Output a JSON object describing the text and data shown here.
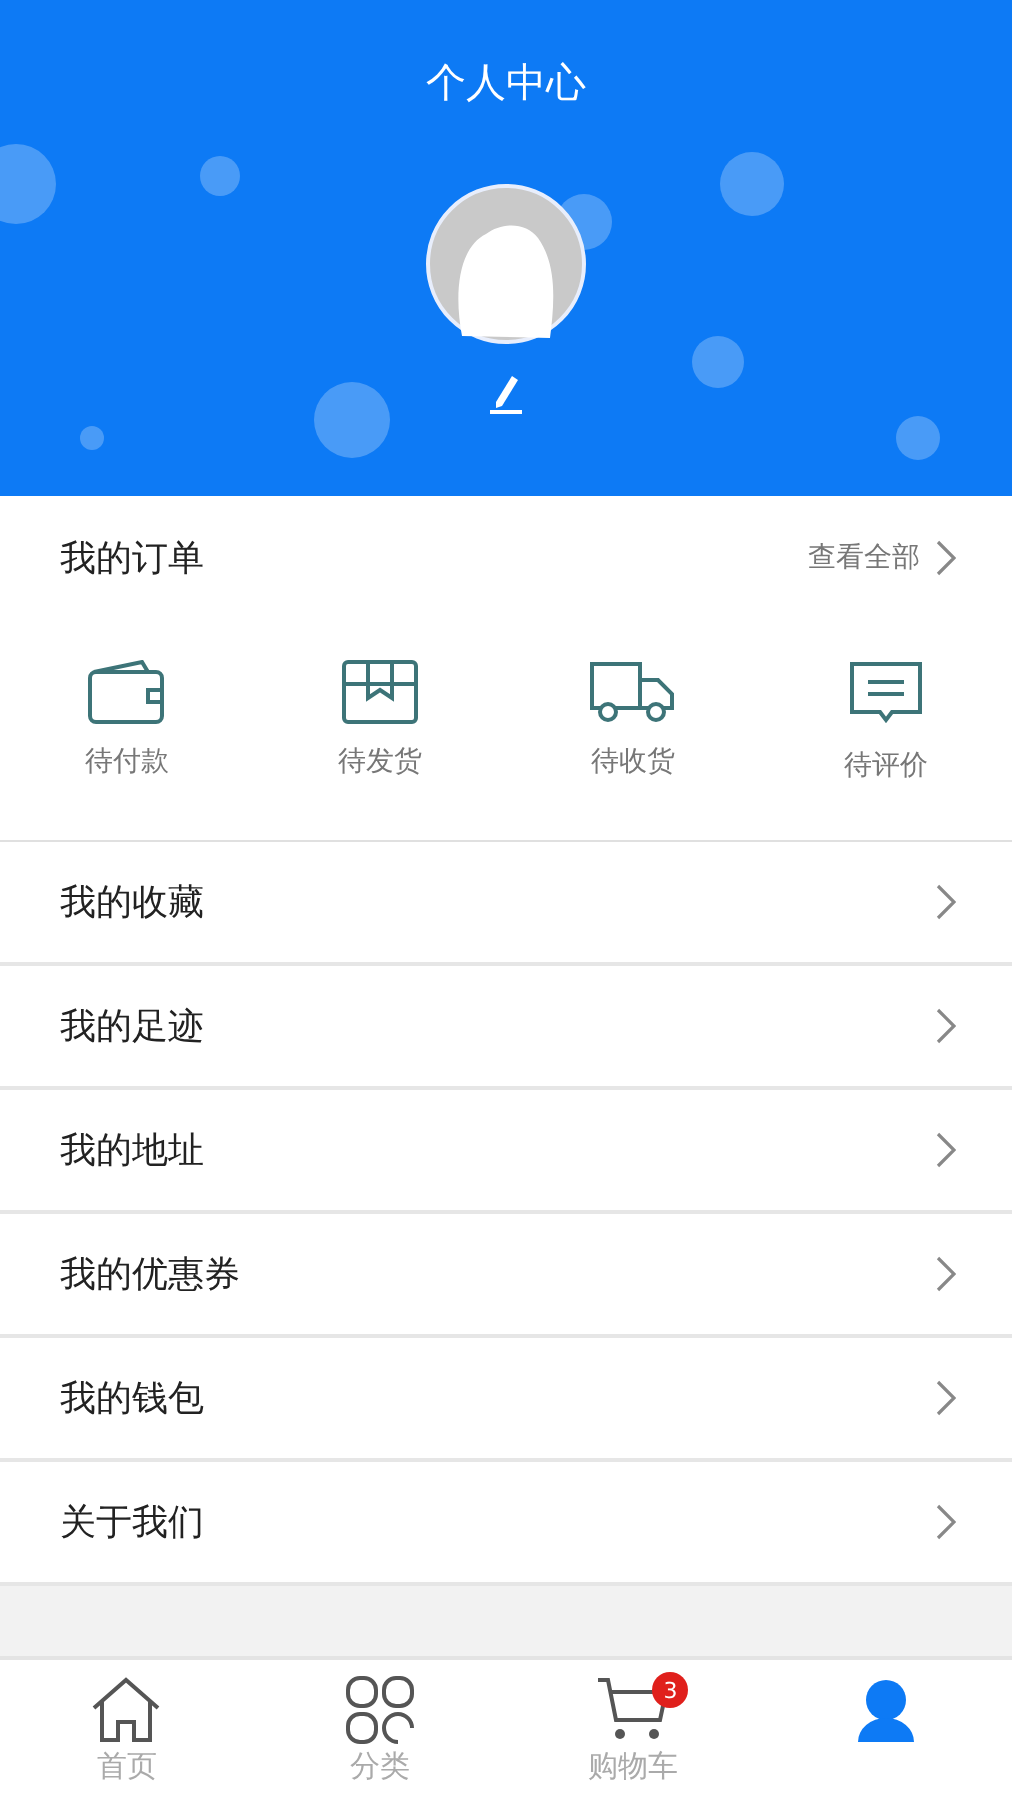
{
  "header": {
    "title": "个人中心"
  },
  "orders": {
    "title": "我的订单",
    "view_all": "查看全部",
    "items": [
      {
        "kind": "wallet",
        "label": "待付款"
      },
      {
        "kind": "box",
        "label": "待发货"
      },
      {
        "kind": "truck",
        "label": "待收货"
      },
      {
        "kind": "comment",
        "label": "待评价"
      }
    ]
  },
  "menu": [
    "我的收藏",
    "我的足迹",
    "我的地址",
    "我的优惠券",
    "我的钱包",
    "关于我们"
  ],
  "tab_bar": [
    {
      "kind": "home",
      "label": "首页",
      "selected": false
    },
    {
      "kind": "grid",
      "label": "分类",
      "selected": false
    },
    {
      "kind": "cart",
      "label": "购物车",
      "badge": "3",
      "selected": false
    },
    {
      "kind": "user",
      "selected": true
    }
  ]
}
